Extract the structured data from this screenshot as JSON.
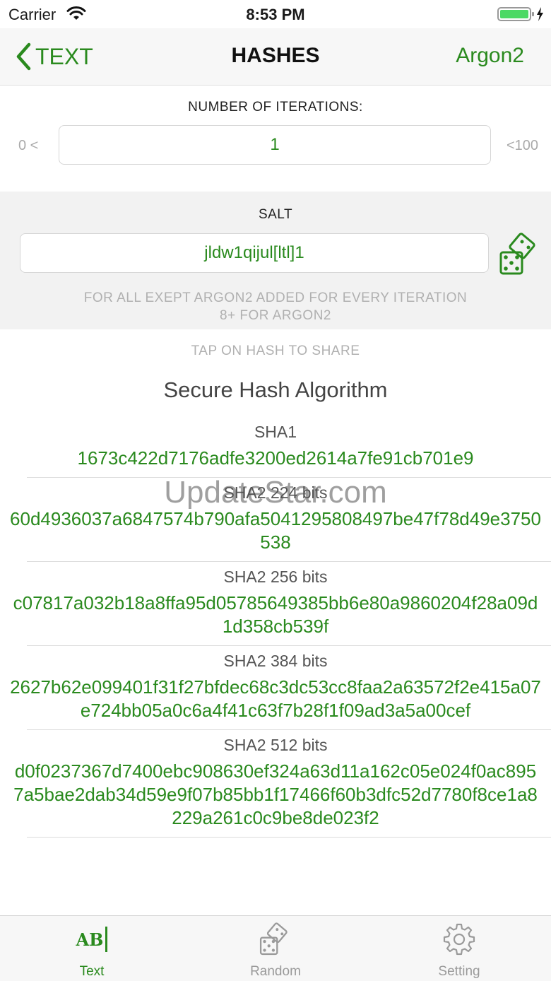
{
  "status_bar": {
    "carrier": "Carrier",
    "time": "8:53 PM"
  },
  "nav": {
    "back_label": "TEXT",
    "title": "HASHES",
    "right_label": "Argon2"
  },
  "iterations": {
    "label": "NUMBER OF ITERATIONS:",
    "min_label": "0 <",
    "max_label": "<100",
    "value": "1"
  },
  "salt": {
    "label": "SALT",
    "value": "jldw1qijul[ltl]1",
    "note_line1": "FOR ALL EXEPT ARGON2 ADDED FOR EVERY ITERATION",
    "note_line2": "8+ FOR ARGON2"
  },
  "hint": "TAP ON HASH TO SHARE",
  "section_title": "Secure Hash Algorithm",
  "hashes": [
    {
      "name": "SHA1",
      "value": "1673c422d7176adfe3200ed2614a7fe91cb701e9"
    },
    {
      "name": "SHA2 224 bits",
      "value": "60d4936037a6847574b790afa5041295808497be47f78d49e3750538"
    },
    {
      "name": "SHA2 256 bits",
      "value": "c07817a032b18a8ffa95d05785649385bb6e80a9860204f28a09d1d358cb539f"
    },
    {
      "name": "SHA2 384 bits",
      "value": "2627b62e099401f31f27bfdec68c3dc53cc8faa2a63572f2e415a07e724bb05a0c6a4f41c63f7b28f1f09ad3a5a00cef"
    },
    {
      "name": "SHA2 512 bits",
      "value": "d0f0237367d7400ebc908630ef324a63d11a162c05e024f0ac8957a5bae2dab34d59e9f07b85bb1f17466f60b3dfc52d7780f8ce1a8229a261c0c9be8de023f2"
    }
  ],
  "watermark": "UpdateStar.com",
  "tabs": [
    {
      "label": "Text",
      "icon": "ab-text-icon",
      "active": true
    },
    {
      "label": "Random",
      "icon": "dice-icon",
      "active": false
    },
    {
      "label": "Setting",
      "icon": "gear-icon",
      "active": false
    }
  ],
  "colors": {
    "accent": "#2a8a1e",
    "muted": "#b0b0b0"
  }
}
